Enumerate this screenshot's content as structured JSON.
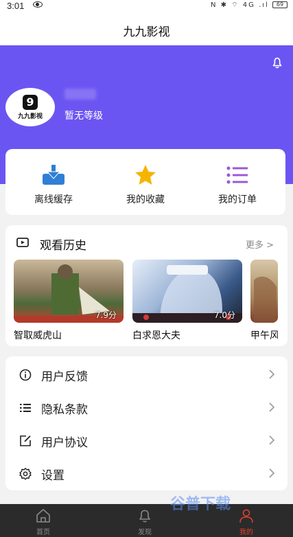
{
  "status_bar": {
    "time": "3:01",
    "icons": "N ✱ ⌔ 4G .ıl",
    "battery": "69"
  },
  "header": {
    "title": "九九影视"
  },
  "profile": {
    "avatar_glyph": "9",
    "avatar_name": "九九影视",
    "level": "暂无等级"
  },
  "quick_actions": [
    {
      "label": "离线缓存",
      "icon": "download-icon",
      "color": "#2f7fd6"
    },
    {
      "label": "我的收藏",
      "icon": "star-icon",
      "color": "#f5b400"
    },
    {
      "label": "我的订单",
      "icon": "list-icon",
      "color": "#9b59d6"
    }
  ],
  "history": {
    "title": "观看历史",
    "more": "更多 >",
    "items": [
      {
        "title": "智取威虎山",
        "score": "7.9分"
      },
      {
        "title": "白求恩大夫",
        "score": "7.0分"
      },
      {
        "title": "甲午风云",
        "score": ""
      }
    ]
  },
  "menu": [
    {
      "label": "用户反馈",
      "icon": "info-icon"
    },
    {
      "label": "隐私条款",
      "icon": "list-icon"
    },
    {
      "label": "用户协议",
      "icon": "edit-icon"
    },
    {
      "label": "设置",
      "icon": "gear-icon"
    }
  ],
  "tabs": [
    {
      "label": "首页",
      "icon": "home-icon"
    },
    {
      "label": "发现",
      "icon": "bell-icon"
    },
    {
      "label": "我的",
      "icon": "user-icon",
      "active": true
    }
  ],
  "watermark": "谷普下载",
  "colors": {
    "accent": "#6b55f2",
    "active_tab": "#e0402f"
  }
}
